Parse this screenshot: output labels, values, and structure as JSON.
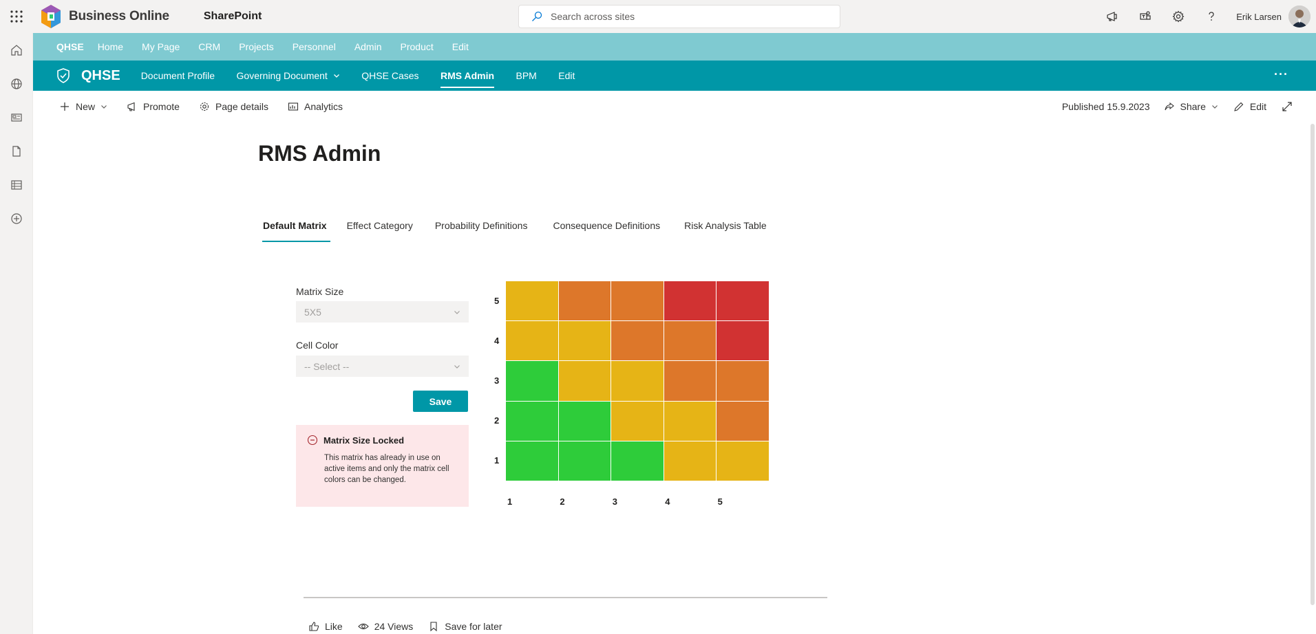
{
  "suite": {
    "brand": "Business Online",
    "app": "SharePoint",
    "search_placeholder": "Search across sites",
    "user": "Erik Larsen"
  },
  "hub_nav": {
    "title": "QHSE",
    "items": [
      "Home",
      "My Page",
      "CRM",
      "Projects",
      "Personnel",
      "Admin",
      "Product",
      "Edit"
    ]
  },
  "site": {
    "title": "QHSE",
    "nav": [
      "Document Profile",
      "Governing Document",
      "QHSE Cases",
      "RMS Admin",
      "BPM",
      "Edit"
    ],
    "active_nav": "RMS Admin",
    "more": "···"
  },
  "command_bar": {
    "new": "New",
    "promote": "Promote",
    "page_details": "Page details",
    "analytics": "Analytics",
    "published": "Published 15.9.2023",
    "share": "Share",
    "edit": "Edit"
  },
  "page": {
    "title": "RMS Admin",
    "tabs": [
      "Default Matrix",
      "Effect Category",
      "Probability Definitions",
      "Consequence Definitions",
      "Risk Analysis Table"
    ],
    "active_tab": "Default Matrix"
  },
  "form": {
    "matrix_size_label": "Matrix Size",
    "matrix_size_value": "5X5",
    "cell_color_label": "Cell Color",
    "cell_color_value": "-- Select --",
    "save_label": "Save"
  },
  "message": {
    "title": "Matrix Size Locked",
    "body": "This matrix has already in use on active items and only the matrix cell colors can be changed."
  },
  "matrix": {
    "colors": {
      "G": "#2ecc3a",
      "Y": "#e6b416",
      "O": "#dd772a",
      "R": "#d13232"
    },
    "rows": [
      {
        "label": "5",
        "cells": [
          "Y",
          "O",
          "O",
          "R",
          "R"
        ]
      },
      {
        "label": "4",
        "cells": [
          "Y",
          "Y",
          "O",
          "O",
          "R"
        ]
      },
      {
        "label": "3",
        "cells": [
          "G",
          "Y",
          "Y",
          "O",
          "O"
        ]
      },
      {
        "label": "2",
        "cells": [
          "G",
          "G",
          "Y",
          "Y",
          "O"
        ]
      },
      {
        "label": "1",
        "cells": [
          "G",
          "G",
          "G",
          "Y",
          "Y"
        ]
      }
    ],
    "x_labels": [
      "1",
      "2",
      "3",
      "4",
      "5"
    ]
  },
  "footer": {
    "like": "Like",
    "views": "24 Views",
    "save_for_later": "Save for later"
  }
}
